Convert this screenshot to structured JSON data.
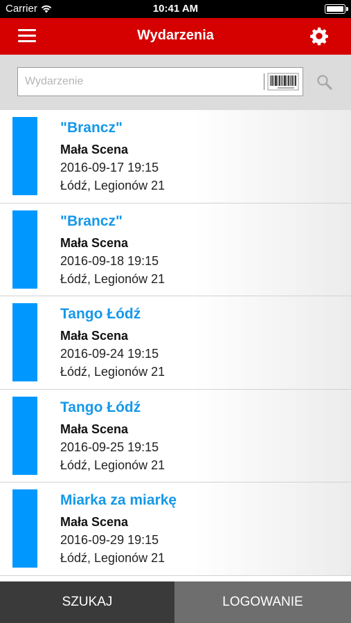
{
  "status_bar": {
    "carrier": "Carrier",
    "time": "10:41 AM",
    "icons": [
      "wifi-icon",
      "battery-icon"
    ]
  },
  "nav": {
    "title": "Wydarzenia",
    "menu_icon": "hamburger-menu-icon",
    "settings_icon": "gear-icon",
    "background_color": "#d50000"
  },
  "search": {
    "placeholder": "Wydarzenie",
    "value": "",
    "barcode_icon": "barcode-icon",
    "search_icon": "search-icon"
  },
  "events": [
    {
      "title": "\"Brancz\"",
      "venue": "Mała Scena",
      "datetime": "2016-09-17 19:15",
      "location": "Łódź, Legionów 21"
    },
    {
      "title": "\"Brancz\"",
      "venue": "Mała Scena",
      "datetime": "2016-09-18 19:15",
      "location": "Łódź, Legionów 21"
    },
    {
      "title": "Tango Łódź",
      "venue": "Mała Scena",
      "datetime": "2016-09-24 19:15",
      "location": "Łódź, Legionów 21"
    },
    {
      "title": "Tango Łódź",
      "venue": "Mała Scena",
      "datetime": "2016-09-25 19:15",
      "location": "Łódź, Legionów 21"
    },
    {
      "title": "Miarka za miarkę",
      "venue": "Mała Scena",
      "datetime": "2016-09-29 19:15",
      "location": "Łódź, Legionów 21"
    }
  ],
  "tabs": [
    {
      "label": "SZUKAJ",
      "active": true
    },
    {
      "label": "LOGOWANIE",
      "active": false
    }
  ],
  "colors": {
    "accent": "#0098ff",
    "event_title": "#1598e8",
    "tab_active": "#3a3a3a",
    "tab_inactive": "#6e6e6e"
  }
}
